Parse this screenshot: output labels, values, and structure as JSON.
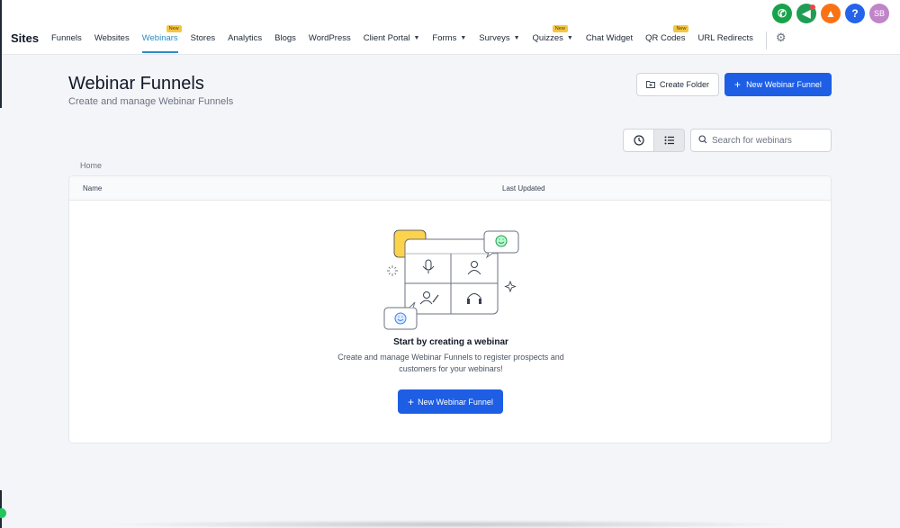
{
  "top_icons": [
    {
      "name": "phone-icon",
      "glyph": "✆",
      "color": "#16a34a"
    },
    {
      "name": "megaphone-icon",
      "glyph": "✉",
      "color": "#1f9d55"
    },
    {
      "name": "bell-icon",
      "glyph": "🔔",
      "color": "#f97316"
    },
    {
      "name": "help-icon",
      "glyph": "?",
      "color": "#2563eb"
    }
  ],
  "avatar_initials": "SB",
  "brand": "Sites",
  "nav": [
    {
      "label": "Funnels"
    },
    {
      "label": "Websites"
    },
    {
      "label": "Webinars",
      "active": true,
      "badge": "New"
    },
    {
      "label": "Stores"
    },
    {
      "label": "Analytics"
    },
    {
      "label": "Blogs"
    },
    {
      "label": "WordPress"
    },
    {
      "label": "Client Portal",
      "dropdown": true
    },
    {
      "label": "Forms",
      "dropdown": true
    },
    {
      "label": "Surveys",
      "dropdown": true
    },
    {
      "label": "Quizzes",
      "dropdown": true,
      "badge": "New"
    },
    {
      "label": "Chat Widget"
    },
    {
      "label": "QR Codes",
      "badge": "New"
    },
    {
      "label": "URL Redirects"
    }
  ],
  "header": {
    "title": "Webinar Funnels",
    "subtitle": "Create and manage Webinar Funnels",
    "create_folder": "Create Folder",
    "new_funnel": "New Webinar Funnel"
  },
  "search": {
    "placeholder": "Search for webinars"
  },
  "breadcrumb": "Home",
  "table": {
    "columns": [
      "Name",
      "Last Updated"
    ]
  },
  "empty_state": {
    "title": "Start by creating a webinar",
    "description": "Create and manage Webinar Funnels to register prospects and customers for your webinars!",
    "button": "New Webinar Funnel"
  },
  "colors": {
    "accent": "#1d5ee5",
    "active_nav": "#2a8ec4",
    "badge": "#f5c642"
  }
}
